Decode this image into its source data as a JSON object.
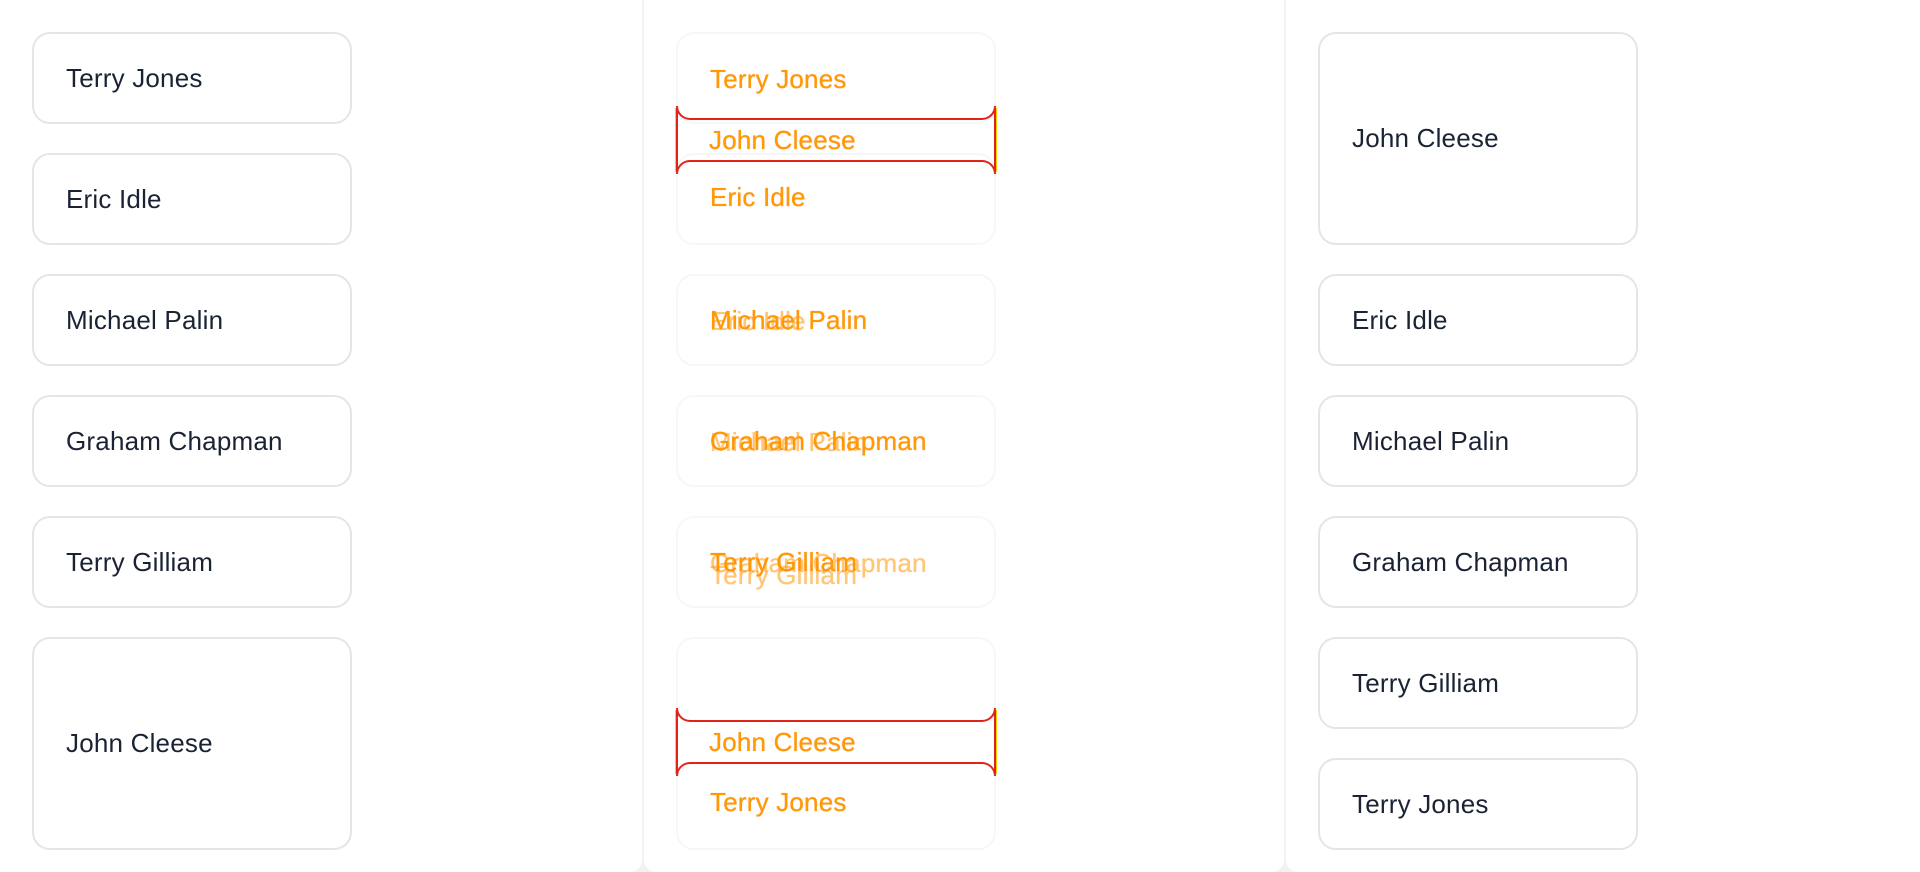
{
  "panels": [
    {
      "id": "original",
      "cards": [
        "Terry Jones",
        "Eric Idle",
        "Michael Palin",
        "Graham Chapman",
        "Terry Gilliam",
        "John Cleese"
      ]
    },
    {
      "id": "transition",
      "cards": [
        "Terry Jones",
        "Eric Idle",
        "Michael Palin",
        "Graham Chapman",
        "Terry Gilliam",
        "Terry Jones"
      ],
      "moving": [
        "John Cleese",
        "John Cleese"
      ],
      "blended": [
        "Eric Idle",
        "Michael Palin",
        "Graham Chapman",
        "Terry Gilliam"
      ]
    },
    {
      "id": "result",
      "cards": [
        "John Cleese",
        "Eric Idle",
        "Michael Palin",
        "Graham Chapman",
        "Terry Gilliam",
        "Terry Jones"
      ]
    }
  ],
  "colors": {
    "text": "#1a2333",
    "card_border": "#e3e5e9",
    "ghost_text": "#ff9b00",
    "bracket": "#e2231a",
    "bracket_glow": "#ffd000"
  }
}
